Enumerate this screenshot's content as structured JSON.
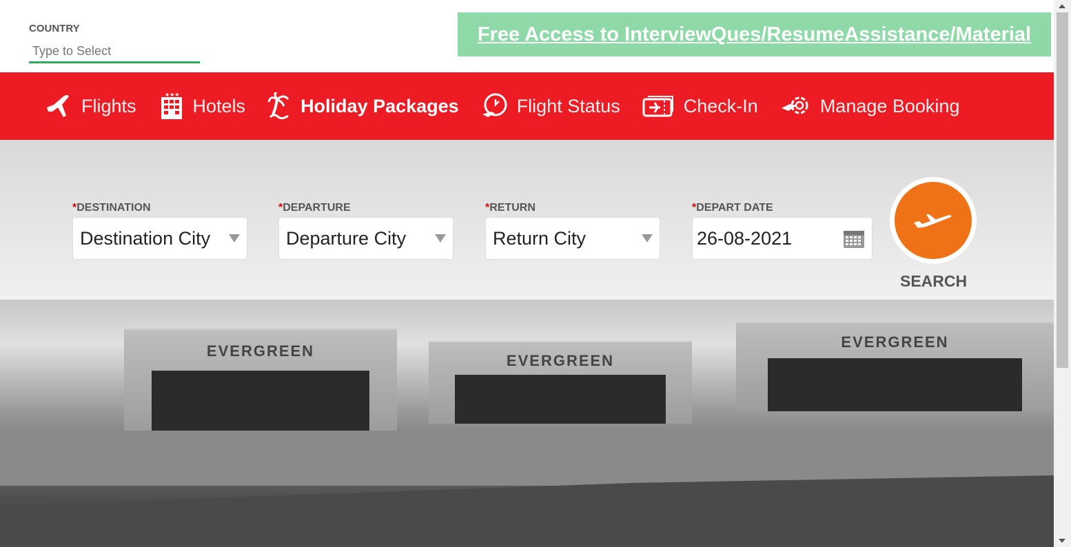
{
  "country": {
    "label": "COUNTRY",
    "placeholder": "Type to Select"
  },
  "promo": {
    "text": "Free Access to InterviewQues/ResumeAssistance/Material"
  },
  "nav": [
    {
      "label": "Flights",
      "icon": "airplane-icon"
    },
    {
      "label": "Hotels",
      "icon": "hotel-icon"
    },
    {
      "label": "Holiday Packages",
      "icon": "palm-tree-icon",
      "active": true
    },
    {
      "label": "Flight Status",
      "icon": "clock-plane-icon"
    },
    {
      "label": "Check-In",
      "icon": "ticket-icon"
    },
    {
      "label": "Manage Booking",
      "icon": "gear-plane-icon"
    }
  ],
  "form": {
    "destination": {
      "label": "DESTINATION",
      "value": "Destination City"
    },
    "departure": {
      "label": "DEPARTURE",
      "value": "Departure City"
    },
    "return": {
      "label": "RETURN",
      "value": "Return City"
    },
    "depart_date": {
      "label": "DEPART DATE",
      "value": "26-08-2021"
    },
    "required_mark": "*",
    "search_label": "SEARCH"
  },
  "hero": {
    "signs": [
      "EVERGREEN",
      "EVERGREEN",
      "EVERGREEN"
    ]
  },
  "colors": {
    "nav": "#ed1c24",
    "search": "#f07216",
    "promo": "#8fd9a8"
  }
}
